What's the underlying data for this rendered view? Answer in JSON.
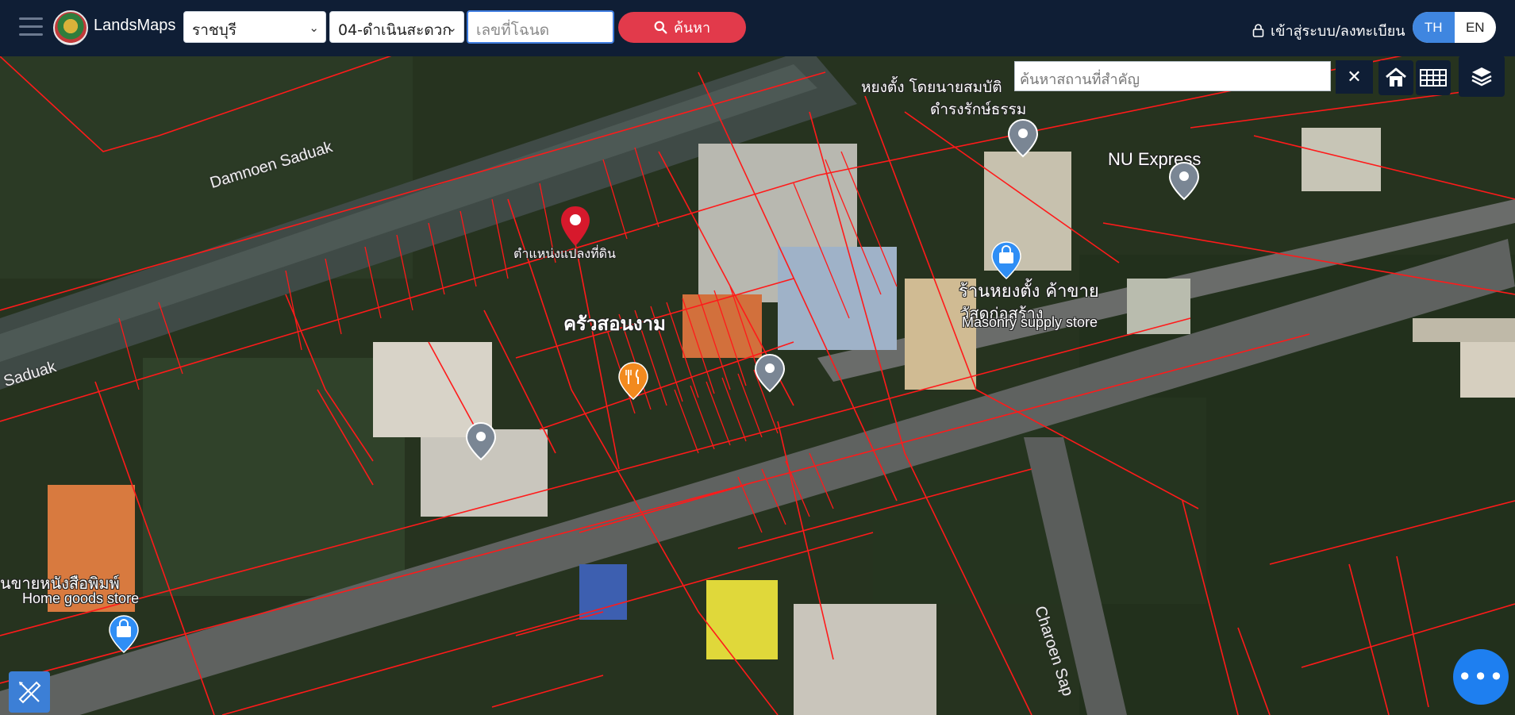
{
  "header": {
    "brand": "LandsMaps",
    "province_select": "ราชบุรี",
    "district_select": "04-ดำเนินสะดวก",
    "deed_placeholder": "เลขที่โฉนด",
    "search_button": "ค้นหา",
    "login_link": "เข้าสู่ระบบ/ลงทะเบียน",
    "lang_th": "TH",
    "lang_en": "EN"
  },
  "map": {
    "landmark_search_placeholder": "ค้นหาสถานที่สำคัญ",
    "roads": {
      "road_1": "Damnoen Saduak",
      "road_2": "Saduak",
      "road_3": "Charoen Sap"
    },
    "labels": {
      "parcel_marker": "ตำแหน่งแปลงที่ดิน",
      "restaurant": "ครัวสอนงาม",
      "shop_th_1": "หยงตั้ง โดยนายสมบัติ",
      "shop_th_2": "ดำรงรักษ์ธรรม",
      "nu_express": "NU Express",
      "hardware_th_1": "ร้านหยงตั้ง ค้าขาย",
      "hardware_th_2": "วัสดุก่อสร้าง",
      "hardware_en": "Masonry supply store",
      "book_th": "นขายหนังสือพิมพ์",
      "book_en": "Home goods store"
    },
    "icons": {
      "marker": "map-pin-icon",
      "restaurant": "restaurant-icon",
      "shop": "shopping-bag-icon",
      "poi": "poi-icon"
    },
    "colors": {
      "parcel_lines": "#ff1a1a",
      "marker": "#d7192c",
      "restaurant_pin": "#f28a1e",
      "shop_pin": "#2f8ef5",
      "poi_pin": "#7a8694",
      "topbar": "#0f1e35",
      "accent_red": "#e23a4b",
      "accent_blue": "#3f86e0"
    }
  }
}
